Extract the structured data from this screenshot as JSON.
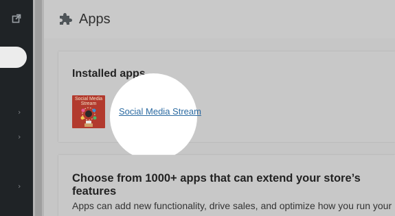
{
  "sidebar": {
    "external_icon": "external-link-icon",
    "chevron_icon": "chevron-right-icon",
    "chevrons": [
      "›",
      "›",
      "›"
    ]
  },
  "header": {
    "icon": "puzzle-piece-icon",
    "title": "Apps"
  },
  "installed": {
    "heading": "Installed apps",
    "apps": [
      {
        "name": "Social Media Stream",
        "thumbnail_text": "Social Media Stream",
        "thumbnail_color": "#b23a2e"
      }
    ]
  },
  "discover": {
    "heading": "Choose from 1000+ apps that can extend your store’s features",
    "description": "Apps can add new functionality, drive sales, and optimize how you run your"
  },
  "colors": {
    "sidebar": "#1f2326",
    "link": "#2b6aa1",
    "spotlight": "#ffffff"
  }
}
